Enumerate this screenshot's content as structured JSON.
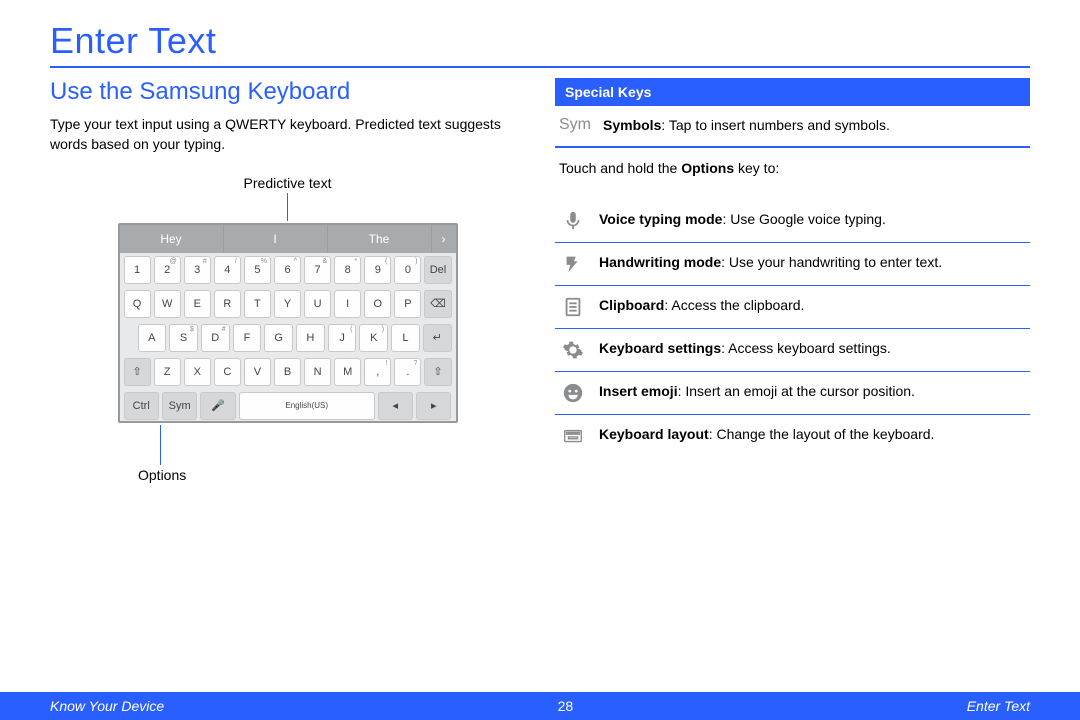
{
  "title": "Enter Text",
  "left": {
    "heading": "Use the Samsung Keyboard",
    "body": "Type your text input using a QWERTY keyboard. Predicted text suggests words based on your typing.",
    "callout_top": "Predictive text",
    "callout_bottom": "Options",
    "predict": [
      "Hey",
      "I",
      "The",
      "›"
    ],
    "row1": [
      {
        "k": "1",
        "s": ""
      },
      {
        "k": "2",
        "s": "@"
      },
      {
        "k": "3",
        "s": "#"
      },
      {
        "k": "4",
        "s": "/"
      },
      {
        "k": "5",
        "s": "%"
      },
      {
        "k": "6",
        "s": "^"
      },
      {
        "k": "7",
        "s": "&"
      },
      {
        "k": "8",
        "s": "*"
      },
      {
        "k": "9",
        "s": "("
      },
      {
        "k": "0",
        "s": ")"
      },
      {
        "k": "Del",
        "s": ""
      }
    ],
    "row2": [
      {
        "k": "Q"
      },
      {
        "k": "W"
      },
      {
        "k": "E"
      },
      {
        "k": "R"
      },
      {
        "k": "T"
      },
      {
        "k": "Y"
      },
      {
        "k": "U"
      },
      {
        "k": "I"
      },
      {
        "k": "O"
      },
      {
        "k": "P"
      },
      {
        "k": "⌫"
      }
    ],
    "row3": [
      {
        "k": "A"
      },
      {
        "k": "S",
        "s": "$"
      },
      {
        "k": "D",
        "s": "#"
      },
      {
        "k": "F"
      },
      {
        "k": "G"
      },
      {
        "k": "H"
      },
      {
        "k": "J",
        "s": "("
      },
      {
        "k": "K",
        "s": ")"
      },
      {
        "k": "L"
      },
      {
        "k": "↵"
      }
    ],
    "row4": [
      {
        "k": "⇧"
      },
      {
        "k": "Z"
      },
      {
        "k": "X"
      },
      {
        "k": "C"
      },
      {
        "k": "V"
      },
      {
        "k": "B"
      },
      {
        "k": "N"
      },
      {
        "k": "M"
      },
      {
        "k": ",",
        "s": "!"
      },
      {
        "k": ".",
        "s": "?"
      },
      {
        "k": "⇧"
      }
    ],
    "row5": [
      {
        "k": "Ctrl"
      },
      {
        "k": "Sym"
      },
      {
        "k": "🎤"
      },
      {
        "k": "English(US)"
      },
      {
        "k": "◂"
      },
      {
        "k": "▸"
      }
    ]
  },
  "right": {
    "bar": "Special Keys",
    "sym_label": "Sym",
    "sym_title": "Symbols",
    "sym_body": ": Tap to insert numbers and symbols.",
    "hold_intro_a": "Touch and hold the ",
    "hold_intro_b": "Options",
    "hold_intro_c": " key to:",
    "opts": [
      {
        "title": "Voice typing mode",
        "body": ": Use Google voice typing."
      },
      {
        "title": "Handwriting mode",
        "body": ": Use your handwriting to enter text."
      },
      {
        "title": "Clipboard",
        "body": ": Access the clipboard."
      },
      {
        "title": "Keyboard settings",
        "body": ": Access keyboard settings."
      },
      {
        "title": "Insert emoji",
        "body": ": Insert an emoji at the cursor position."
      },
      {
        "title": "Keyboard layout",
        "body": ": Change the layout of the keyboard."
      }
    ]
  },
  "footer": {
    "left": "Know Your Device",
    "page": "28",
    "right": "Enter Text"
  }
}
